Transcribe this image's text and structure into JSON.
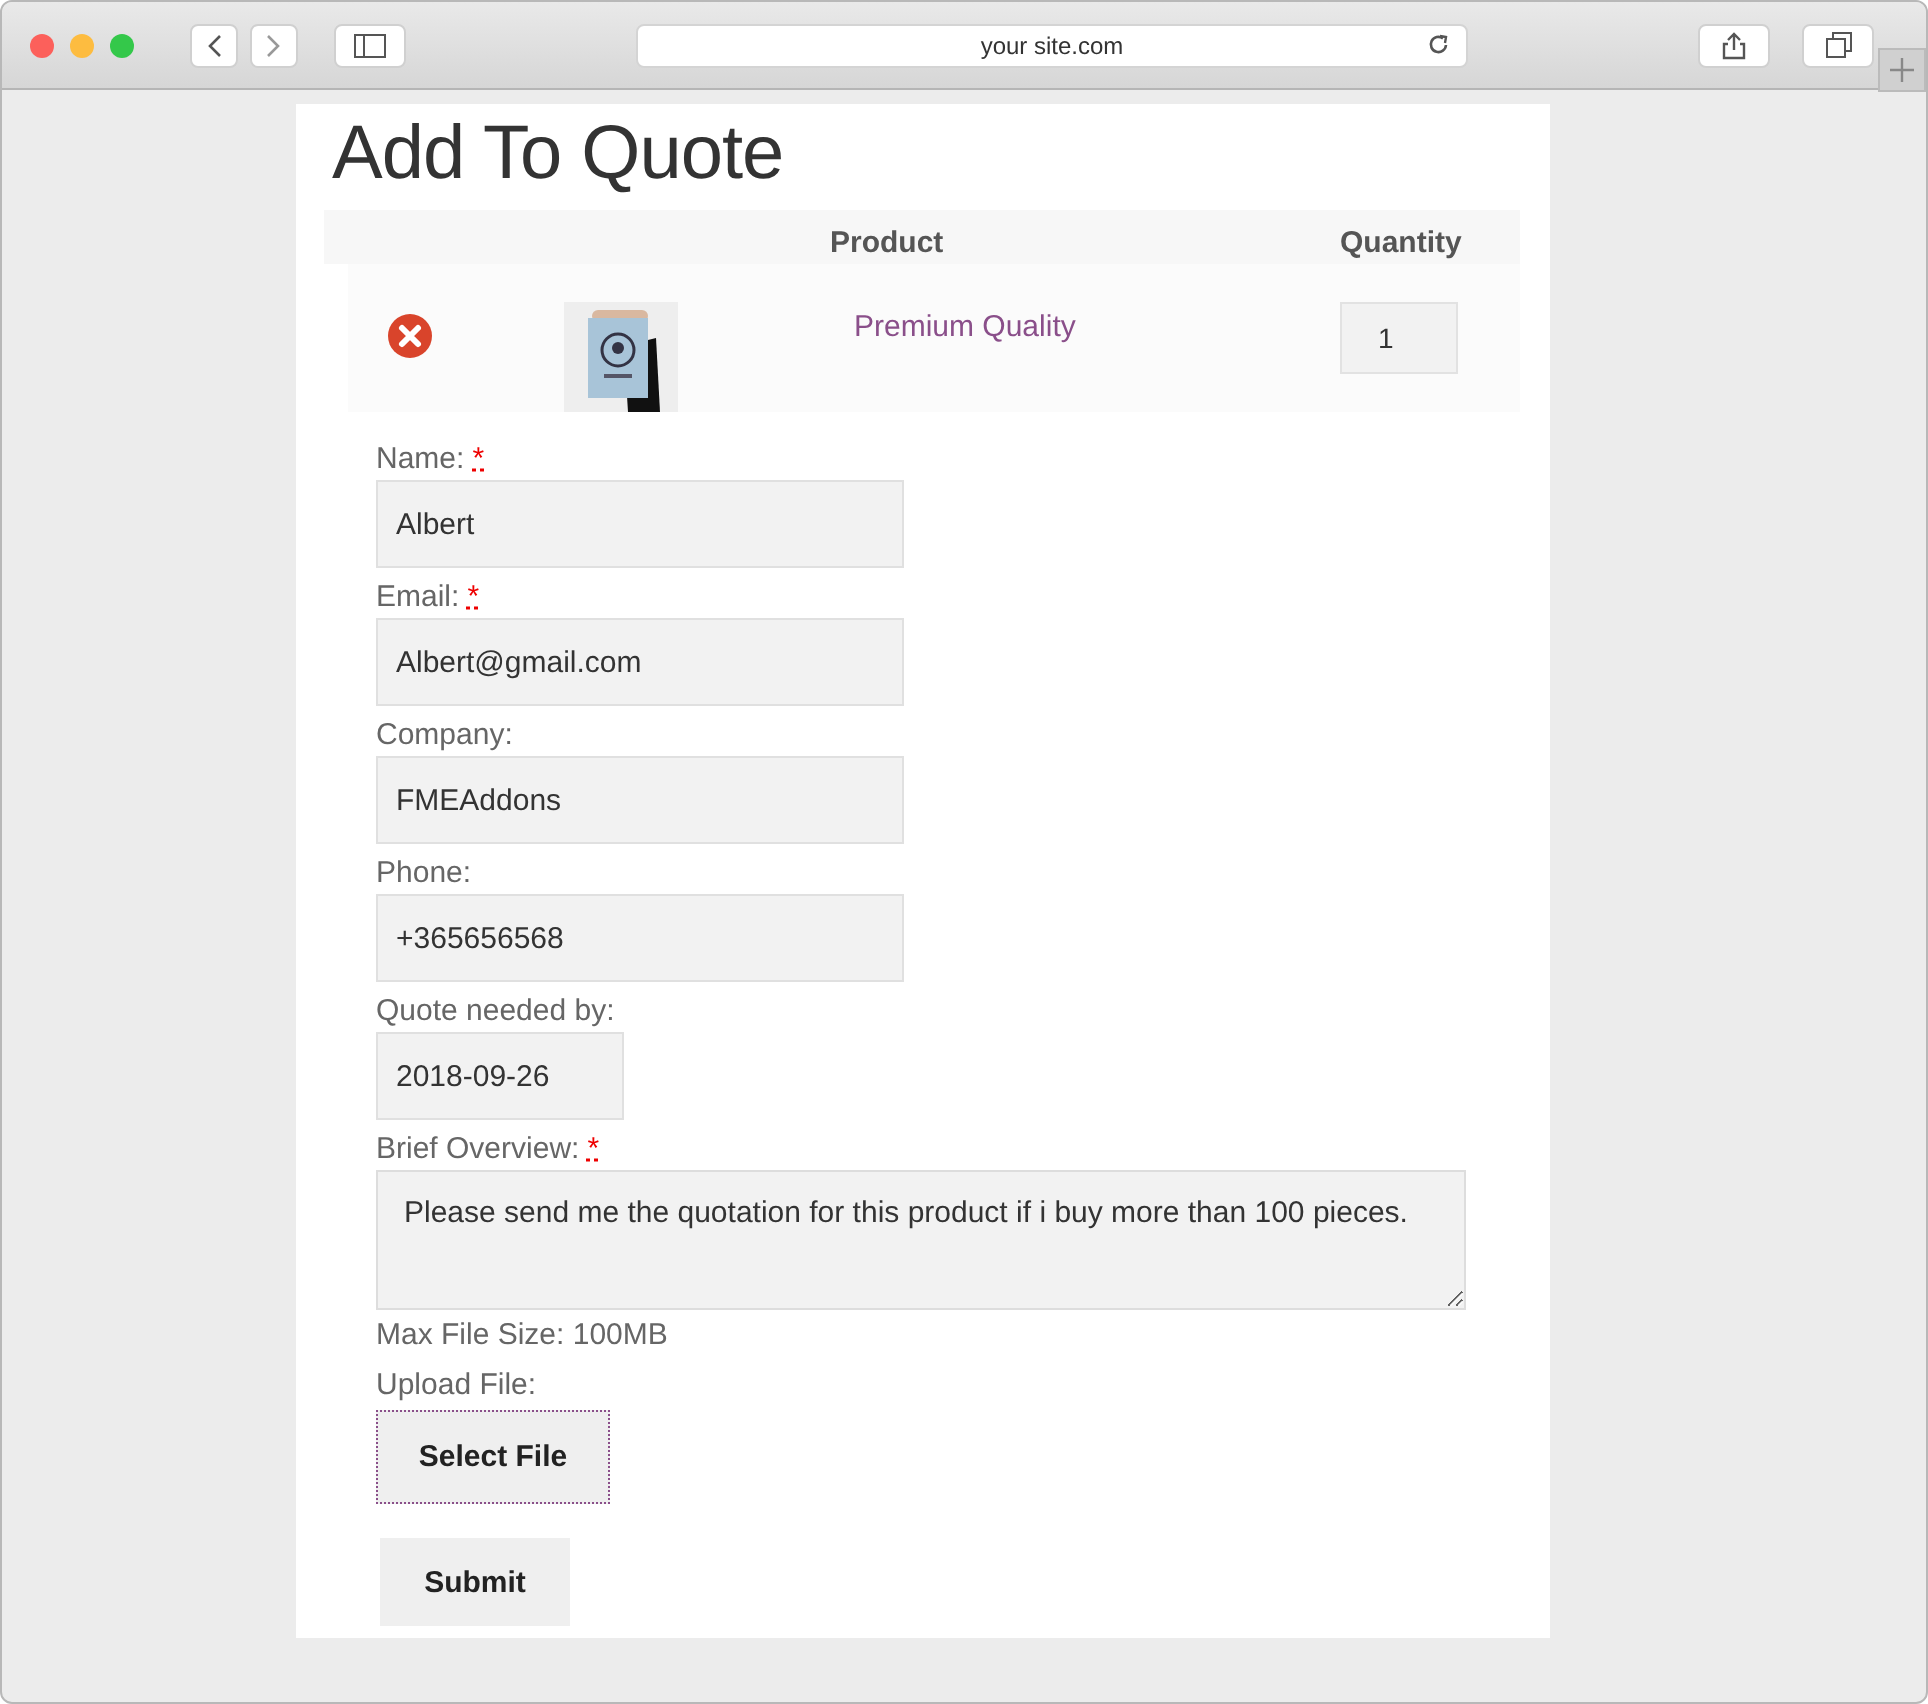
{
  "browser": {
    "url": "your site.com"
  },
  "page": {
    "title": "Add To Quote",
    "table": {
      "columns": [
        "Product",
        "Quantity"
      ],
      "rows": [
        {
          "product": "Premium Quality",
          "quantity": "1"
        }
      ]
    },
    "fields": [
      {
        "label": "Name:",
        "required": true,
        "kind": "text",
        "value": "Albert"
      },
      {
        "label": "Email:",
        "required": true,
        "kind": "text",
        "value": "Albert@gmail.com"
      },
      {
        "label": "Company:",
        "required": false,
        "kind": "text",
        "value": "FMEAddons"
      },
      {
        "label": "Phone:",
        "required": false,
        "kind": "text",
        "value": "+365656568"
      },
      {
        "label": "Quote needed by:",
        "required": false,
        "kind": "date",
        "value": "2018-09-26"
      },
      {
        "label": "Brief Overview:",
        "required": true,
        "kind": "textarea",
        "value": "Please send me the quotation for this product if i buy more than 100 pieces."
      }
    ],
    "required_mark": "*",
    "max_file_size": "Max File Size: 100MB",
    "upload": {
      "label": "Upload File:",
      "button": "Select File"
    },
    "submit": "Submit"
  }
}
